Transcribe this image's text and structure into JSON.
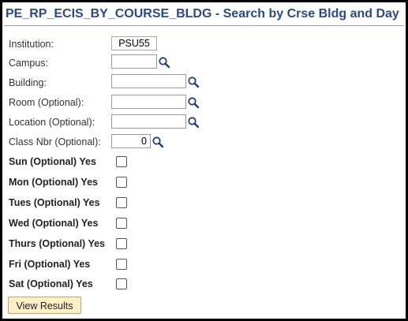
{
  "page": {
    "title": "PE_RP_ECIS_BY_COURSE_BLDG - Search by Crse Bldg and Day"
  },
  "fields": {
    "institution": {
      "label": "Institution:",
      "value": "PSU55"
    },
    "campus": {
      "label": "Campus:",
      "value": ""
    },
    "building": {
      "label": "Building:",
      "value": ""
    },
    "room": {
      "label": "Room (Optional):",
      "value": ""
    },
    "location": {
      "label": "Location (Optional):",
      "value": ""
    },
    "class_nbr": {
      "label": "Class Nbr (Optional):",
      "value": "0"
    }
  },
  "days": {
    "sun": {
      "label": "Sun (Optional) Yes",
      "checked": false
    },
    "mon": {
      "label": "Mon (Optional) Yes",
      "checked": false
    },
    "tues": {
      "label": "Tues (Optional) Yes",
      "checked": false
    },
    "wed": {
      "label": "Wed (Optional) Yes",
      "checked": false
    },
    "thurs": {
      "label": "Thurs (Optional) Yes",
      "checked": false
    },
    "fri": {
      "label": "Fri (Optional) Yes",
      "checked": false
    },
    "sat": {
      "label": "Sat (Optional) Yes",
      "checked": false
    }
  },
  "actions": {
    "view_results_label": "View Results"
  },
  "icons": {
    "lookup": "magnifier-icon"
  },
  "colors": {
    "title": "#2a4a84",
    "button_bg": "#fdefc8",
    "button_border": "#c9a25e",
    "frame_border": "#000000"
  }
}
